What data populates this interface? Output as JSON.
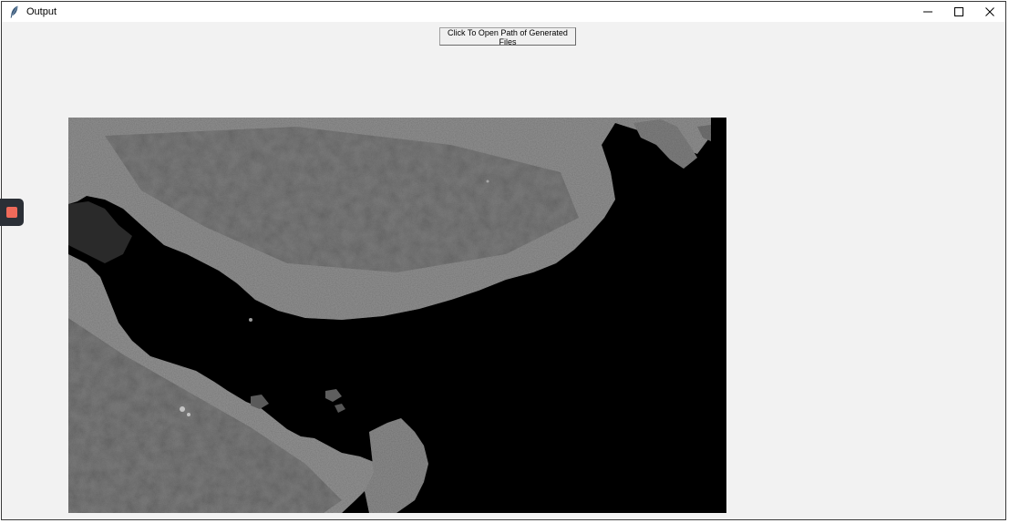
{
  "window": {
    "title": "Output",
    "app_icon": "feather-icon",
    "controls": {
      "minimize_icon": "minimize-icon",
      "maximize_icon": "maximize-icon",
      "close_icon": "close-icon"
    }
  },
  "toolbar": {
    "open_path_label": "Click To Open Path of Generated Files"
  },
  "image": {
    "description_kind": "satellite-image"
  },
  "side_widget": {
    "icon": "stop-icon",
    "color": "#f06a5a"
  }
}
